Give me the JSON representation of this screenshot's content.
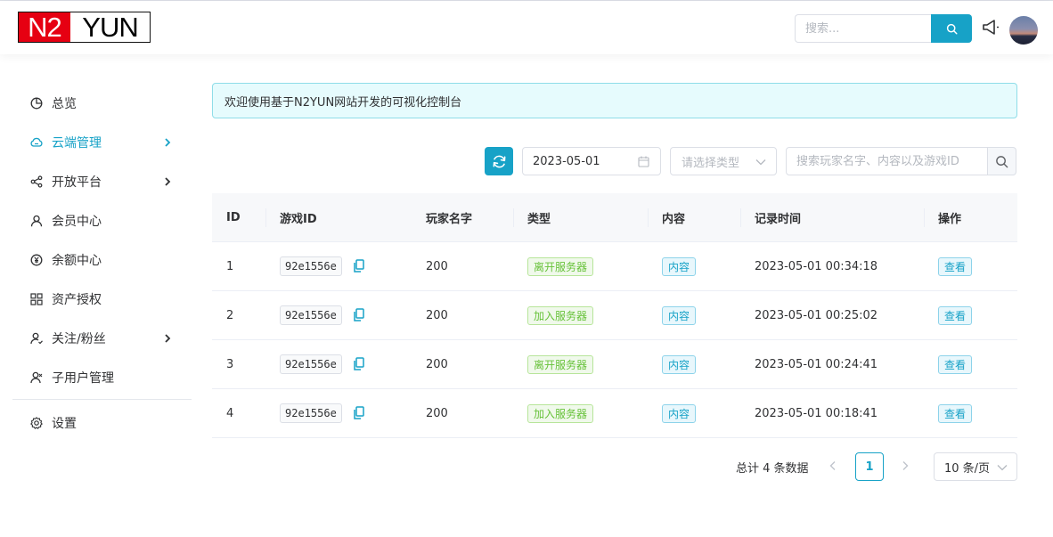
{
  "header": {
    "logo_left": "N2",
    "logo_right": "YUN",
    "search_placeholder": "搜索...",
    "accent_color": "#17a2c7",
    "logo_red": "#e60012"
  },
  "sidebar": {
    "items": [
      {
        "label": "总览",
        "icon": "pie-chart-icon",
        "active": false,
        "has_arrow": false
      },
      {
        "label": "云端管理",
        "icon": "cloud-icon",
        "active": true,
        "has_arrow": true
      },
      {
        "label": "开放平台",
        "icon": "share-icon",
        "active": false,
        "has_arrow": true
      },
      {
        "label": "会员中心",
        "icon": "user-icon",
        "active": false,
        "has_arrow": false
      },
      {
        "label": "余额中心",
        "icon": "yen-icon",
        "active": false,
        "has_arrow": false
      },
      {
        "label": "资产授权",
        "icon": "grid-icon",
        "active": false,
        "has_arrow": false
      },
      {
        "label": "关注/粉丝",
        "icon": "user-follow-icon",
        "active": false,
        "has_arrow": true
      },
      {
        "label": "子用户管理",
        "icon": "users-icon",
        "active": false,
        "has_arrow": false
      },
      {
        "label": "设置",
        "icon": "gear-icon",
        "active": false,
        "has_arrow": false
      }
    ]
  },
  "alert": {
    "text": "欢迎使用基于N2YUN网站开发的可视化控制台"
  },
  "toolbar": {
    "date_value": "2023-05-01",
    "type_placeholder": "请选择类型",
    "keyword_placeholder": "搜索玩家名字、内容以及游戏ID"
  },
  "table": {
    "columns": [
      "ID",
      "游戏ID",
      "玩家名字",
      "类型",
      "内容",
      "记录时间",
      "操作"
    ],
    "rows": [
      {
        "id": "1",
        "game_id": "92e1556e",
        "player": "200",
        "type": "离开服务器",
        "content": "内容",
        "time": "2023-05-01 00:34:18",
        "action": "查看"
      },
      {
        "id": "2",
        "game_id": "92e1556e",
        "player": "200",
        "type": "加入服务器",
        "content": "内容",
        "time": "2023-05-01 00:25:02",
        "action": "查看"
      },
      {
        "id": "3",
        "game_id": "92e1556e",
        "player": "200",
        "type": "离开服务器",
        "content": "内容",
        "time": "2023-05-01 00:24:41",
        "action": "查看"
      },
      {
        "id": "4",
        "game_id": "92e1556e",
        "player": "200",
        "type": "加入服务器",
        "content": "内容",
        "time": "2023-05-01 00:18:41",
        "action": "查看"
      }
    ]
  },
  "pagination": {
    "total_text": "总计 4 条数据",
    "current_page": "1",
    "page_size": "10 条/页"
  }
}
